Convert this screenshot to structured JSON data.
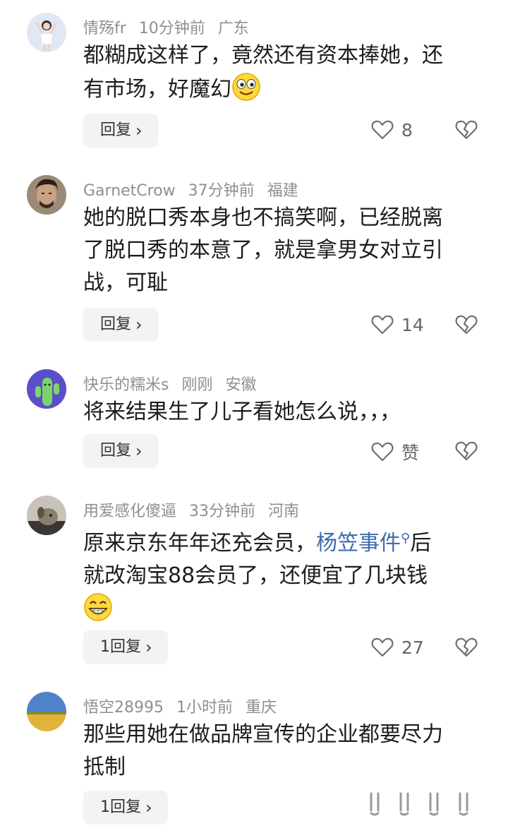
{
  "comments": [
    {
      "user": "情殇fr",
      "time": "10分钟前",
      "location": "广东",
      "text_line1": "都糊成这样了，竟然还有资本捧她，还",
      "text_line2": "有市场，好魔幻",
      "reply_label": "回复",
      "likes": "8",
      "avatar_icon": "girl-avatar",
      "text_emoji": "grinning-face-emoji"
    },
    {
      "user": "GarnetCrow",
      "time": "37分钟前",
      "location": "福建",
      "text_line1": "她的脱口秀本身也不搞笑啊，已经脱离",
      "text_line2": "了脱口秀的本意了，就是拿男女对立引",
      "text_line3": "战，可耻",
      "reply_label": "回复",
      "likes": "14",
      "avatar_icon": "man-portrait-avatar"
    },
    {
      "user": "快乐的糯米s",
      "time": "刚刚",
      "location": "安徽",
      "text_line1": "将来结果生了儿子看她怎么说，，，",
      "reply_label": "回复",
      "likes": "赞",
      "avatar_icon": "cactus-avatar"
    },
    {
      "user": "用爱感化傻逼",
      "time": "33分钟前",
      "location": "河南",
      "text_line1_before": "原来京东年年还充会员，",
      "text_link": "杨笠事件",
      "text_line1_after": "后",
      "text_line2": "就改淘宝88会员了，还便宜了几块钱",
      "reply_label": "1回复",
      "likes": "27",
      "avatar_icon": "dog-avatar",
      "text_emoji": "big-grin-emoji",
      "link_icon": "search-icon"
    },
    {
      "user": "悟空28995",
      "time": "1小时前",
      "location": "重庆",
      "text_line1": "那些用她在做品牌宣传的企业都要尽力",
      "text_line2": "抵制",
      "reply_label": "1回复",
      "avatar_icon": "field-landscape-avatar"
    }
  ]
}
